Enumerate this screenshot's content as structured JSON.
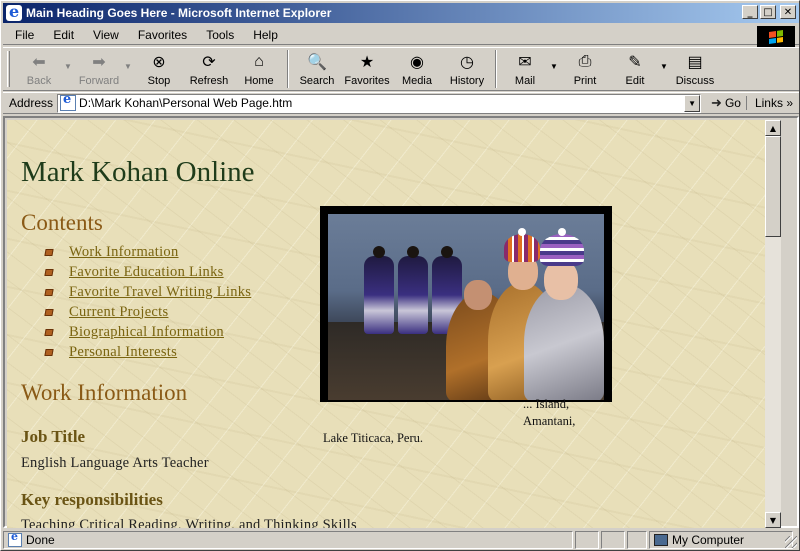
{
  "window": {
    "title": "Main Heading Goes Here - Microsoft Internet Explorer",
    "minimize": "_",
    "maximize": "□",
    "close": "✕"
  },
  "menu": {
    "items": [
      {
        "label": "File"
      },
      {
        "label": "Edit"
      },
      {
        "label": "View"
      },
      {
        "label": "Favorites"
      },
      {
        "label": "Tools"
      },
      {
        "label": "Help"
      }
    ]
  },
  "toolbar": {
    "buttons": [
      {
        "label": "Back",
        "icon": "back-arrow-icon",
        "enabled": false
      },
      {
        "label": "Forward",
        "icon": "forward-arrow-icon",
        "enabled": false
      },
      {
        "label": "Stop",
        "icon": "stop-icon",
        "enabled": true
      },
      {
        "label": "Refresh",
        "icon": "refresh-icon",
        "enabled": true
      },
      {
        "label": "Home",
        "icon": "home-icon",
        "enabled": true
      },
      {
        "label": "Search",
        "icon": "search-icon",
        "enabled": true
      },
      {
        "label": "Favorites",
        "icon": "favorites-icon",
        "enabled": true
      },
      {
        "label": "Media",
        "icon": "media-icon",
        "enabled": true
      },
      {
        "label": "History",
        "icon": "history-icon",
        "enabled": true
      },
      {
        "label": "Mail",
        "icon": "mail-icon",
        "enabled": true
      },
      {
        "label": "Print",
        "icon": "print-icon",
        "enabled": true
      },
      {
        "label": "Edit",
        "icon": "edit-icon",
        "enabled": true
      },
      {
        "label": "Discuss",
        "icon": "discuss-icon",
        "enabled": true
      }
    ]
  },
  "address": {
    "label": "Address",
    "url": "D:\\Mark Kohan\\Personal Web Page.htm",
    "go_label": "Go",
    "links_label": "Links"
  },
  "page": {
    "title": "Mark Kohan Online",
    "contents_heading": "Contents",
    "toc": [
      {
        "label": "Work Information"
      },
      {
        "label": "Favorite Education Links"
      },
      {
        "label": "Favorite Travel Writing Links"
      },
      {
        "label": "Current Projects"
      },
      {
        "label": "Biographical Information"
      },
      {
        "label": "Personal Interests"
      }
    ],
    "work_heading": "Work Information",
    "job_title_heading": "Job Title",
    "job_title_text": "English Language Arts Teacher",
    "key_resp_heading": "Key responsibilities",
    "key_resp_text": "Teaching Critical Reading, Writing, and Thinking Skills",
    "photo_caption_line1": "... Island, Amantani,",
    "photo_caption_line2": "Lake Titicaca, Peru."
  },
  "status": {
    "text": "Done",
    "zone": "My Computer"
  },
  "colors": {
    "title_bar_start": "#0a246a",
    "title_bar_end": "#a6caf0",
    "page_background": "#e8dfb9",
    "heading_main": "#1f3c1a",
    "heading_section": "#8a5a16",
    "link": "#7a6410"
  }
}
